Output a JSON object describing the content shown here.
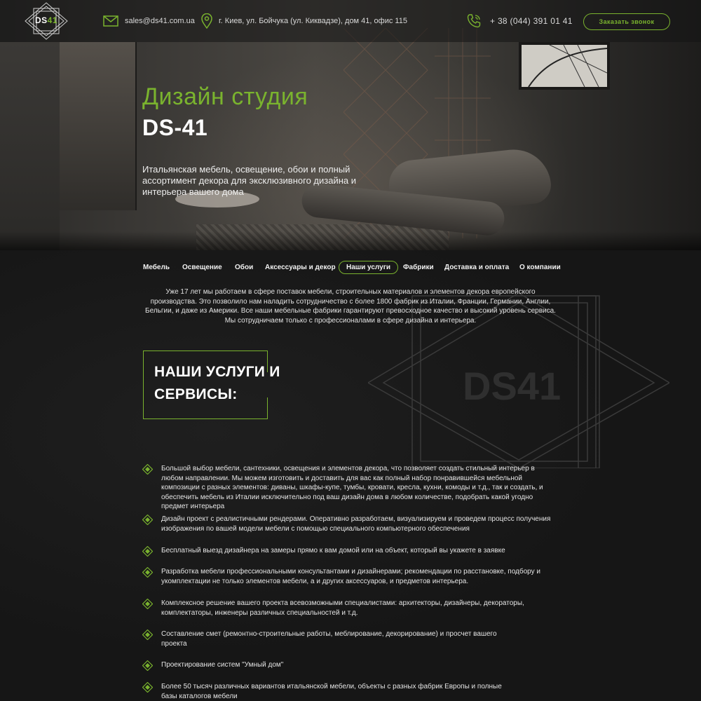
{
  "header": {
    "logo": {
      "main": "DS",
      "accent": "41"
    },
    "email": "sales@ds41.com.ua",
    "address": "г. Киев, ул. Бойчука (ул. Киквадзе), дом 41, офис 115",
    "phone": "+ 38 (044) 391 01 41",
    "callback_label": "Заказать звонок",
    "icons": [
      "envelope-icon",
      "location-pin-icon",
      "phone-icon"
    ]
  },
  "hero": {
    "title": "Дизайн студия",
    "brand": "DS-41",
    "description": "Итальянская мебель, освещение, обои и полный ассортимент декора для эксклюзивного дизайна и интерьера вашего дома"
  },
  "nav": {
    "items": [
      {
        "label": "Мебель"
      },
      {
        "label": "Освещение"
      },
      {
        "label": "Обои"
      },
      {
        "label": "Аксессуары и декор"
      },
      {
        "label": "Наши услуги",
        "active": true
      },
      {
        "label": "Фабрики"
      },
      {
        "label": "Доставка и оплата"
      },
      {
        "label": "О компании"
      }
    ]
  },
  "intro": "Уже 17 лет мы работаем в сфере поставок мебели, строительных материалов и элементов декора европейского производства. Это позволило нам наладить сотрудничество с более 1800 фабрик из Италии, Франции, Германии, Англии, Бельгии, и даже из Америки. Все наши мебельные фабрики гарантируют превосходное качество и высокий уровень сервиса. Мы сотрудничаем только с профессионалами в сфере дизайна и интерьера.",
  "watermark_text": "DS41",
  "services": {
    "title_line1": "НАШИ УСЛУГИ И",
    "title_line2": "СЕРВИСЫ:",
    "items": [
      "Большой выбор мебели, сантехники, освещения и элементов декора, что позволяет создать стильный интерьер в любом направлении. Мы можем изготовить и доставить для вас как полный набор понравившейся мебельной композиции с разных элементов: диваны, шкафы-купе, тумбы, кровати, кресла, кухни, комоды и т.д., так и создать, и обеспечить мебель из Италии исключительно под ваш дизайн дома в любом количестве, подобрать какой угодно предмет интерьера",
      "Дизайн проект с реалистичными рендерами. Оперативно разработаем, визуализируем и проведем процесс получения изображения по вашей модели мебели с помощью специального компьютерного обеспечения",
      "Бесплатный выезд дизайнера на замеры прямо к вам домой или на объект, который вы укажете в заявке",
      "Разработка мебели профессиональными консультантами и дизайнерами; рекомендации по расстановке, подбору и укомплектации не только элементов мебели, а и других аксессуаров, и предметов интерьера.",
      "Комплексное решение вашего проекта всевозможными специалистами: архитекторы, дизайнеры, декораторы, комплектаторы, инженеры различных специальностей и т.д.",
      "Составление смет (ремонтно-строительные работы, меблирование, декорирование) и просчет вашего проекта",
      "Проектирование систем \"Умный дом\"",
      "Более 50 тысяч различных вариантов итальянской мебели, объекты с разных фабрик Европы и полные базы каталогов мебели"
    ]
  },
  "colors": {
    "accent": "#7ab32e",
    "background": "#161616",
    "text": "#e4e4e4"
  }
}
